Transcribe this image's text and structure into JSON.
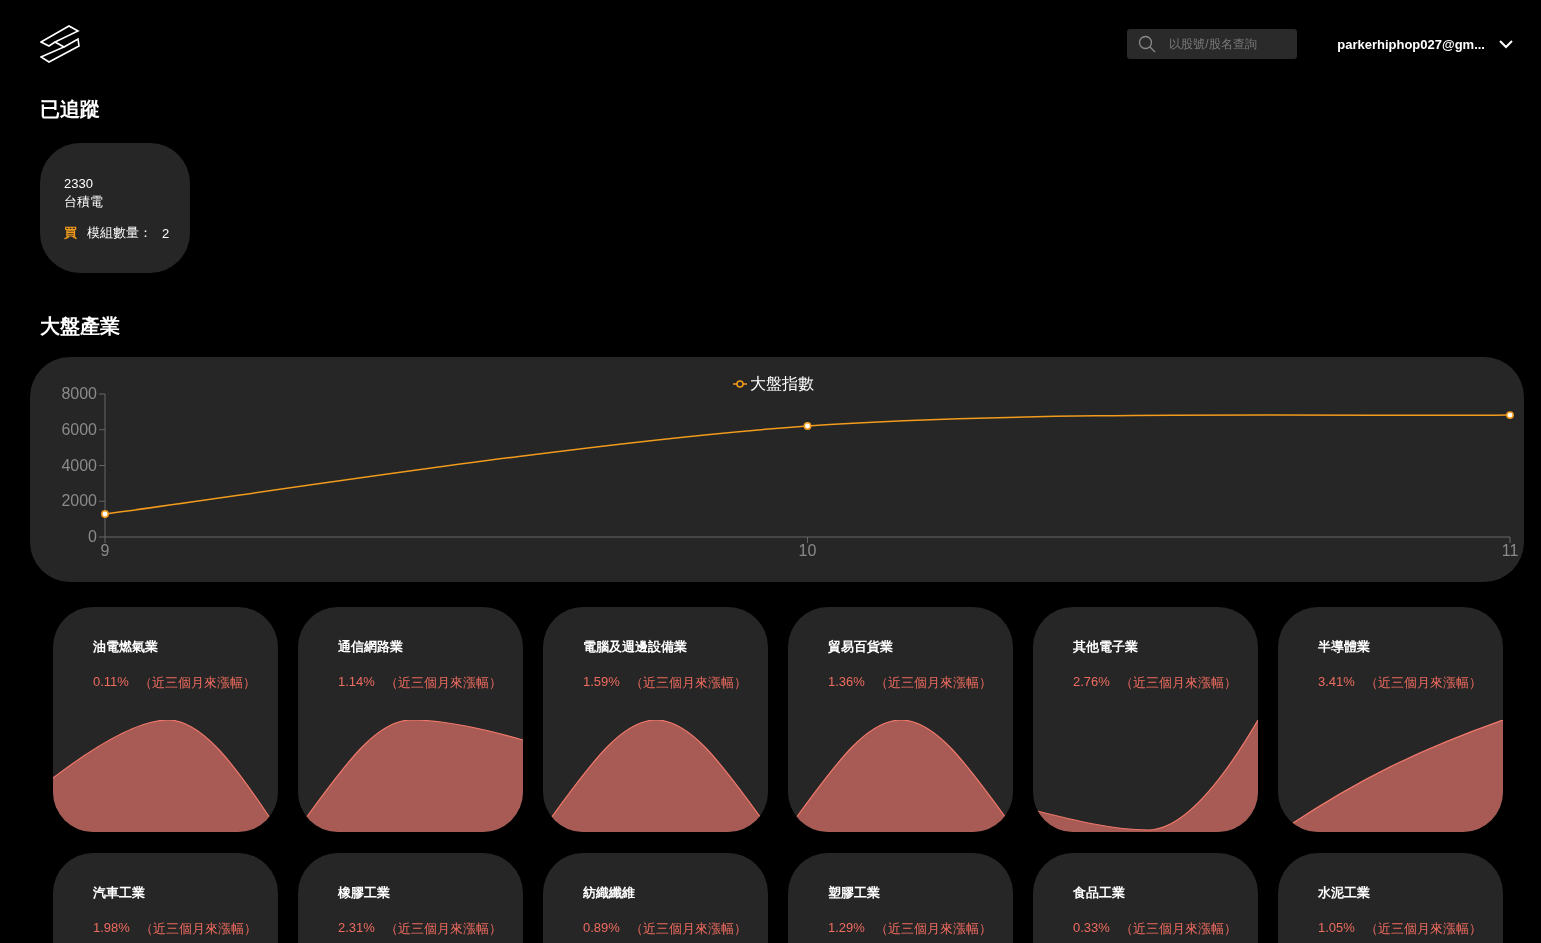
{
  "header": {
    "search": {
      "placeholder": "以股號/股名查詢"
    },
    "account": {
      "email": "parkerhiphop027@gm..."
    }
  },
  "tracked": {
    "title": "已追蹤",
    "cards": [
      {
        "code": "2330",
        "name": "台積電",
        "action": "買",
        "modules_label": "模組數量：",
        "modules": "2"
      }
    ]
  },
  "market": {
    "title": "大盤產業",
    "chart_data": {
      "type": "line",
      "categories": [
        "9",
        "10",
        "11"
      ],
      "series": [
        {
          "name": "大盤指數",
          "color": "#f29b1d",
          "marker": "circle",
          "values": [
            1290,
            6210,
            6820
          ]
        }
      ],
      "ylim": [
        0,
        8000
      ],
      "yticks": [
        0,
        2000,
        4000,
        6000,
        8000
      ]
    }
  },
  "sectors": [
    {
      "name": "油電燃氣業",
      "change": "0.11%",
      "note": "（近三個月來漲幅）",
      "kind": "hump"
    },
    {
      "name": "通信網路業",
      "change": "1.14%",
      "note": "（近三個月來漲幅）",
      "kind": "plateau"
    },
    {
      "name": "電腦及週邊設備業",
      "change": "1.59%",
      "note": "（近三個月來漲幅）",
      "kind": "peak"
    },
    {
      "name": "貿易百貨業",
      "change": "1.36%",
      "note": "（近三個月來漲幅）",
      "kind": "peak"
    },
    {
      "name": "其他電子業",
      "change": "2.76%",
      "note": "（近三個月來漲幅）",
      "kind": "valley"
    },
    {
      "name": "半導體業",
      "change": "3.41%",
      "note": "（近三個月來漲幅）",
      "kind": "rise"
    },
    {
      "name": "汽車工業",
      "change": "1.98%",
      "note": "（近三個月來漲幅）"
    },
    {
      "name": "橡膠工業",
      "change": "2.31%",
      "note": "（近三個月來漲幅）"
    },
    {
      "name": "紡織纖維",
      "change": "0.89%",
      "note": "（近三個月來漲幅）"
    },
    {
      "name": "塑膠工業",
      "change": "1.29%",
      "note": "（近三個月來漲幅）"
    },
    {
      "name": "食品工業",
      "change": "0.33%",
      "note": "（近三個月來漲幅）"
    },
    {
      "name": "水泥工業",
      "change": "1.05%",
      "note": "（近三個月來漲幅）"
    }
  ]
}
